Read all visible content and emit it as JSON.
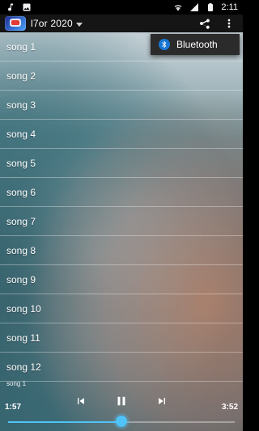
{
  "status_bar": {
    "time": "2:11",
    "icons": [
      "music-icon",
      "image-icon",
      "wifi-icon",
      "signal-icon",
      "battery-icon"
    ]
  },
  "app_bar": {
    "title": "l7or 2020",
    "icons": [
      "app-logo-icon",
      "dropdown-icon",
      "share-icon",
      "more-vert-icon"
    ]
  },
  "popup_menu": {
    "items": [
      {
        "label": "Bluetooth",
        "icon": "bluetooth-icon"
      }
    ]
  },
  "songs": [
    {
      "label": "song 1"
    },
    {
      "label": "song 2"
    },
    {
      "label": "song 3"
    },
    {
      "label": "song 4"
    },
    {
      "label": "song 5"
    },
    {
      "label": "song 6"
    },
    {
      "label": "song 7"
    },
    {
      "label": "song 8"
    },
    {
      "label": "song 9"
    },
    {
      "label": "song 10"
    },
    {
      "label": "song 11"
    },
    {
      "label": "song 12"
    }
  ],
  "player": {
    "now_playing": "song 1",
    "elapsed": "1:57",
    "duration": "3:52",
    "progress_fraction": 0.5,
    "accent": "#4fc3f7",
    "icons": [
      "previous-icon",
      "pause-icon",
      "next-icon"
    ]
  }
}
